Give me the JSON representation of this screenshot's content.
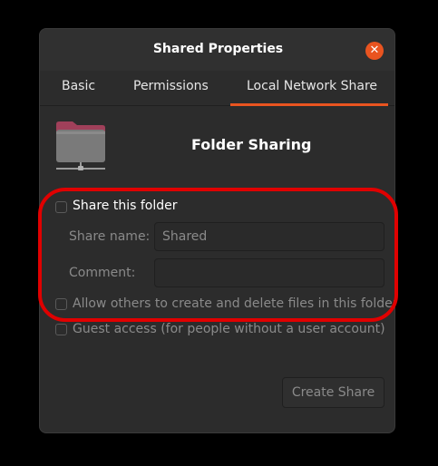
{
  "window": {
    "title": "Shared Properties"
  },
  "tabs": [
    {
      "label": "Basic"
    },
    {
      "label": "Permissions"
    },
    {
      "label": "Local Network Share"
    }
  ],
  "header": {
    "heading": "Folder Sharing",
    "icon": "folder-network-icon"
  },
  "share": {
    "share_this_folder_label": "Share this folder",
    "share_this_folder_checked": false,
    "share_name_label": "Share name:",
    "share_name_value": "Shared",
    "comment_label": "Comment:",
    "comment_value": "",
    "allow_others_label": "Allow others to create and delete files in this folder",
    "allow_others_checked": false,
    "guest_access_label": "Guest access (for people without a user account)",
    "guest_access_checked": false
  },
  "actions": {
    "create_share_label": "Create Share"
  },
  "colors": {
    "accent": "#e95420",
    "highlight": "#e00000",
    "dialog_bg": "#2c2c2c"
  }
}
